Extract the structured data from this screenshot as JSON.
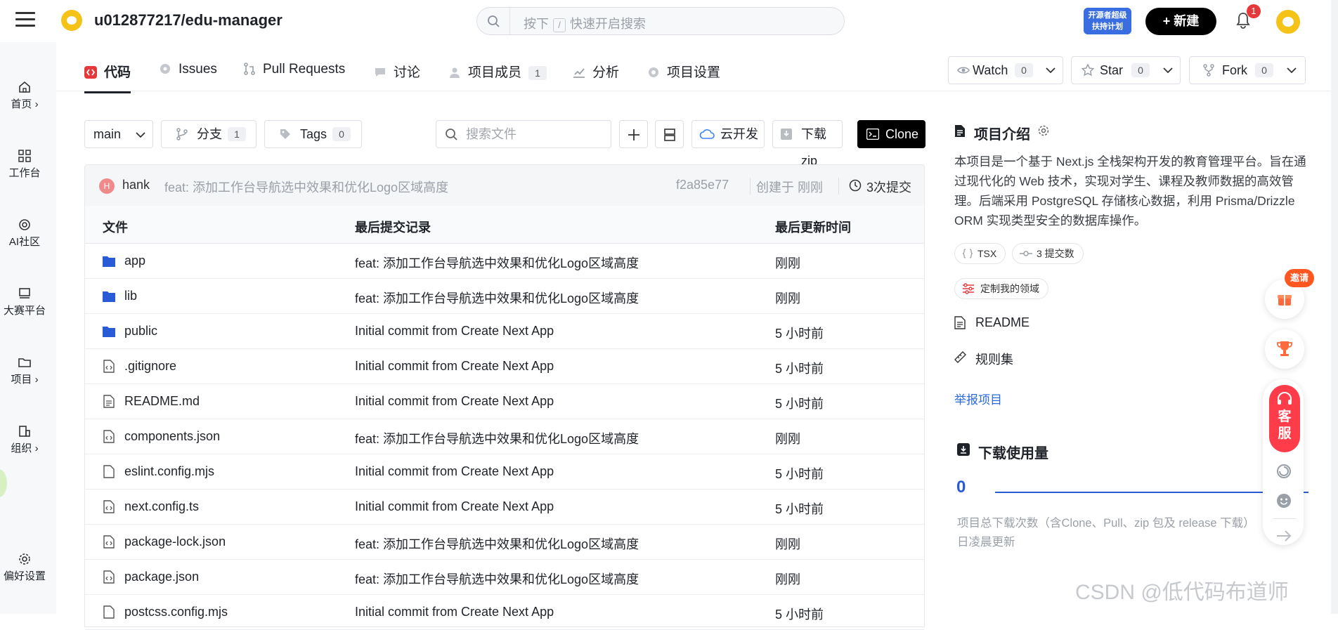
{
  "header": {
    "repo_title": "u012877217/edu-manager",
    "search_placeholder_a": "按下",
    "search_key": "/",
    "search_placeholder_b": "快速开启搜索",
    "promo_line1": "开源者超级",
    "promo_line2": "扶持计划",
    "new_button": "+ 新建",
    "notification_count": "1"
  },
  "sidebar": {
    "items": [
      {
        "label": "首页 ›",
        "icon": "home-icon"
      },
      {
        "label": "工作台",
        "icon": "grid-icon"
      },
      {
        "label": "AI社区",
        "icon": "ai-icon"
      },
      {
        "label": "大赛平台",
        "icon": "trophy-board-icon"
      },
      {
        "label": "项目 ›",
        "icon": "folder-icon"
      },
      {
        "label": "组织 ›",
        "icon": "org-icon"
      },
      {
        "label": "偏好设置",
        "icon": "settings-icon"
      }
    ]
  },
  "tabs": [
    {
      "label": "代码",
      "active": true
    },
    {
      "label": "Issues"
    },
    {
      "label": "Pull Requests"
    },
    {
      "label": "讨论"
    },
    {
      "label": "项目成员",
      "count": "1"
    },
    {
      "label": "分析"
    },
    {
      "label": "项目设置"
    }
  ],
  "repo_actions": {
    "watch_label": "Watch",
    "watch_count": "0",
    "star_label": "Star",
    "star_count": "0",
    "fork_label": "Fork",
    "fork_count": "0"
  },
  "toolbar": {
    "branch": "main",
    "branches_label": "分支",
    "branches_count": "1",
    "tags_label": "Tags",
    "tags_count": "0",
    "file_search_placeholder": "搜索文件",
    "cloud_dev": "云开发",
    "download_zip": "下载zip",
    "clone": "Clone"
  },
  "commit": {
    "avatar_initial": "H",
    "author": "hank",
    "message": "feat: 添加工作台导航选中效果和优化Logo区域高度",
    "hash": "f2a85e77",
    "created": "创建于 刚刚",
    "commit_count": "3次提交"
  },
  "table": {
    "headers": [
      "文件",
      "最后提交记录",
      "最后更新时间"
    ],
    "rows": [
      {
        "name": "app",
        "type": "folder",
        "commit": "feat: 添加工作台导航选中效果和优化Logo区域高度",
        "time": "刚刚"
      },
      {
        "name": "lib",
        "type": "folder",
        "commit": "feat: 添加工作台导航选中效果和优化Logo区域高度",
        "time": "刚刚"
      },
      {
        "name": "public",
        "type": "folder",
        "commit": "Initial commit from Create Next App",
        "time": "5 小时前"
      },
      {
        "name": ".gitignore",
        "type": "code-file",
        "commit": "Initial commit from Create Next App",
        "time": "5 小时前"
      },
      {
        "name": "README.md",
        "type": "text-file",
        "commit": "Initial commit from Create Next App",
        "time": "5 小时前"
      },
      {
        "name": "components.json",
        "type": "code-file",
        "commit": "feat: 添加工作台导航选中效果和优化Logo区域高度",
        "time": "刚刚"
      },
      {
        "name": "eslint.config.mjs",
        "type": "file",
        "commit": "Initial commit from Create Next App",
        "time": "5 小时前"
      },
      {
        "name": "next.config.ts",
        "type": "code-file",
        "commit": "Initial commit from Create Next App",
        "time": "5 小时前"
      },
      {
        "name": "package-lock.json",
        "type": "code-file",
        "commit": "feat: 添加工作台导航选中效果和优化Logo区域高度",
        "time": "刚刚"
      },
      {
        "name": "package.json",
        "type": "code-file",
        "commit": "feat: 添加工作台导航选中效果和优化Logo区域高度",
        "time": "刚刚"
      },
      {
        "name": "postcss.config.mjs",
        "type": "file",
        "commit": "Initial commit from Create Next App",
        "time": "5 小时前"
      }
    ]
  },
  "about": {
    "title": "项目介绍",
    "description": "本项目是一个基于 Next.js 全栈架构开发的教育管理平台。旨在通过现代化的 Web 技术，实现对学生、课程及教师数据的高效管理。后端采用 PostgreSQL 存储核心数据，利用 Prisma/Drizzle ORM 实现类型安全的数据库操作。",
    "lang_chip": "TSX",
    "commits_chip": "3 提交数",
    "customize_chip": "定制我的领域",
    "readme": "README",
    "rules": "规则集",
    "report": "举报项目"
  },
  "downloads": {
    "title": "下载使用量",
    "count": "0",
    "note": "项目总下载次数（含Clone、Pull、zip 包及 release 下载）日凌晨更新"
  },
  "floating": {
    "invite": "邀请",
    "service_line1": "客",
    "service_line2": "服"
  },
  "watermark": "CSDN @低代码布道师",
  "colors": {
    "accent_red": "#e5383b",
    "folder_blue": "#2a5bd7",
    "link_blue": "#2a6ad9",
    "clone_bg": "#000000"
  }
}
